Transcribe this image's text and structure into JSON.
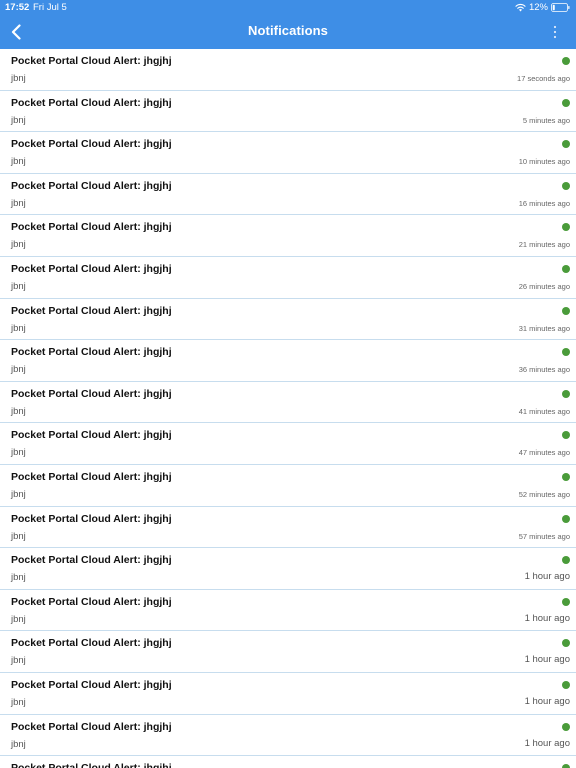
{
  "status_bar": {
    "time": "17:52",
    "date": "Fri Jul 5",
    "battery_percent": "12%",
    "icons": [
      "wifi-icon",
      "battery-icon"
    ]
  },
  "header": {
    "title": "Notifications",
    "back_icon": "chevron-left-icon",
    "menu_icon": "more-vertical-icon"
  },
  "colors": {
    "header_bg": "#3e8ee6",
    "status_dot": "#4a9b3a",
    "divider": "#c7ddee"
  },
  "notifications": [
    {
      "title": "Pocket Portal Cloud Alert: jhgjhj",
      "message": "jbnj",
      "time": "17 seconds ago"
    },
    {
      "title": "Pocket Portal Cloud Alert: jhgjhj",
      "message": "jbnj",
      "time": "5 minutes ago"
    },
    {
      "title": "Pocket Portal Cloud Alert: jhgjhj",
      "message": "jbnj",
      "time": "10 minutes ago"
    },
    {
      "title": "Pocket Portal Cloud Alert: jhgjhj",
      "message": "jbnj",
      "time": "16 minutes ago"
    },
    {
      "title": "Pocket Portal Cloud Alert: jhgjhj",
      "message": "jbnj",
      "time": "21 minutes ago"
    },
    {
      "title": "Pocket Portal Cloud Alert: jhgjhj",
      "message": "jbnj",
      "time": "26 minutes ago"
    },
    {
      "title": "Pocket Portal Cloud Alert: jhgjhj",
      "message": "jbnj",
      "time": "31 minutes ago"
    },
    {
      "title": "Pocket Portal Cloud Alert: jhgjhj",
      "message": "jbnj",
      "time": "36 minutes ago"
    },
    {
      "title": "Pocket Portal Cloud Alert: jhgjhj",
      "message": "jbnj",
      "time": "41 minutes ago"
    },
    {
      "title": "Pocket Portal Cloud Alert: jhgjhj",
      "message": "jbnj",
      "time": "47 minutes ago"
    },
    {
      "title": "Pocket Portal Cloud Alert: jhgjhj",
      "message": "jbnj",
      "time": "52 minutes ago"
    },
    {
      "title": "Pocket Portal Cloud Alert: jhgjhj",
      "message": "jbnj",
      "time": "57 minutes ago"
    },
    {
      "title": "Pocket Portal Cloud Alert: jhgjhj",
      "message": "jbnj",
      "time": "1 hour ago"
    },
    {
      "title": "Pocket Portal Cloud Alert: jhgjhj",
      "message": "jbnj",
      "time": "1 hour ago"
    },
    {
      "title": "Pocket Portal Cloud Alert: jhgjhj",
      "message": "jbnj",
      "time": "1 hour ago"
    },
    {
      "title": "Pocket Portal Cloud Alert: jhgjhj",
      "message": "jbnj",
      "time": "1 hour ago"
    },
    {
      "title": "Pocket Portal Cloud Alert: jhgjhj",
      "message": "jbnj",
      "time": "1 hour ago"
    },
    {
      "title": "Pocket Portal Cloud Alert: jhgjhj",
      "message": "",
      "time": ""
    }
  ]
}
